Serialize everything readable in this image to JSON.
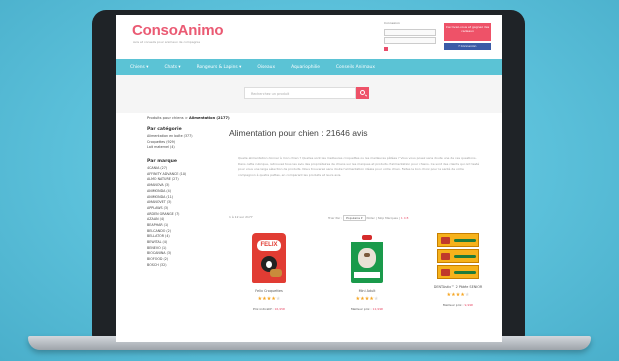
{
  "brand": {
    "logo_text": "ConsoAnimo",
    "tagline": "Avis et conseils pour animaux de compagnie"
  },
  "colors": {
    "background": "#5fc3dc",
    "accent_pink": "#ee5268",
    "nav_teal": "#5bc3d5",
    "facebook": "#3b5ba7"
  },
  "header": {
    "login_label": "Connexion",
    "register_label": "Inscrivez-vous et gagnez des cadeaux",
    "facebook_label": "Connexion"
  },
  "nav": {
    "items": [
      "Chiens ▾",
      "Chats ▾",
      "Rongeurs & Lapins ▾",
      "Oiseaux",
      "Aquariophilie",
      "Conseils Animaux"
    ]
  },
  "search": {
    "placeholder": "Recherchez un produit"
  },
  "breadcrumb": {
    "root": "Produits pour chiens",
    "sep": ">",
    "current": "Alimentation (2177)"
  },
  "sidebar": {
    "category_title": "Par catégorie",
    "categories": [
      "Alimentation en boîte (377)",
      "Croquettes (929)",
      "Lait maternel (4)"
    ],
    "brand_title": "Par marque",
    "brands": [
      "4CANIA (27)",
      "AFFINITY ADVANCE (10)",
      "ALMO NATURE (27)",
      "AMANOVA (3)",
      "ANIMONDA (4)",
      "ANIMONDA (11)",
      "AMANOVET (3)",
      "APPLAWS (3)",
      "ARDEN GRANGE (7)",
      "AZAAN (4)",
      "BEAPHAR (1)",
      "BELCANDO (2)",
      "BELLATOR (4)",
      "BEWITAL (4)",
      "BENEVO (1)",
      "BIOCANINA (3)",
      "BIOFOOD (2)",
      "BOSCH (32)"
    ]
  },
  "main": {
    "title": "Alimentation pour chien : 21646 avis",
    "intro": "Quelle alimentation donner à mon chien ? Quelles sont les meilleures croquettes ou les meilleures pâtées ? Vous vous posez sans doute une de ces questions. Dans cette rubrique, retrouvez tous les avis des propriétaires de chiens sur les marques et produits d'alimentation pour chiens. Ce sont des clients qui ont testé pour vous une large sélection de produits. Nous trouverez sans doute l'alimentation idéale pour votre chien. Faites le bon choix pour la santé de votre compagnon à quatre pattes, en comparant les produits et leurs avis.",
    "count": "1 à 12 sur 2177",
    "sort_label": "Trier Par :",
    "sort_value": "Populaire",
    "sort_extra": "Noter | Skip Marques |",
    "sort_pink": "1 4 8",
    "products": [
      {
        "name": "Felix Croquettes",
        "rating": 4,
        "price_label": "Prix indicatif :",
        "price": "16,95€"
      },
      {
        "name": "Mini Adult",
        "rating": 4,
        "price_label": "Meilleur prix :",
        "price": "12,99€"
      },
      {
        "name": "DENTAstix™ 2 Pâtée SENIOR",
        "rating": 4,
        "price_label": "Meilleur prix :",
        "price": "9,99€"
      }
    ]
  }
}
